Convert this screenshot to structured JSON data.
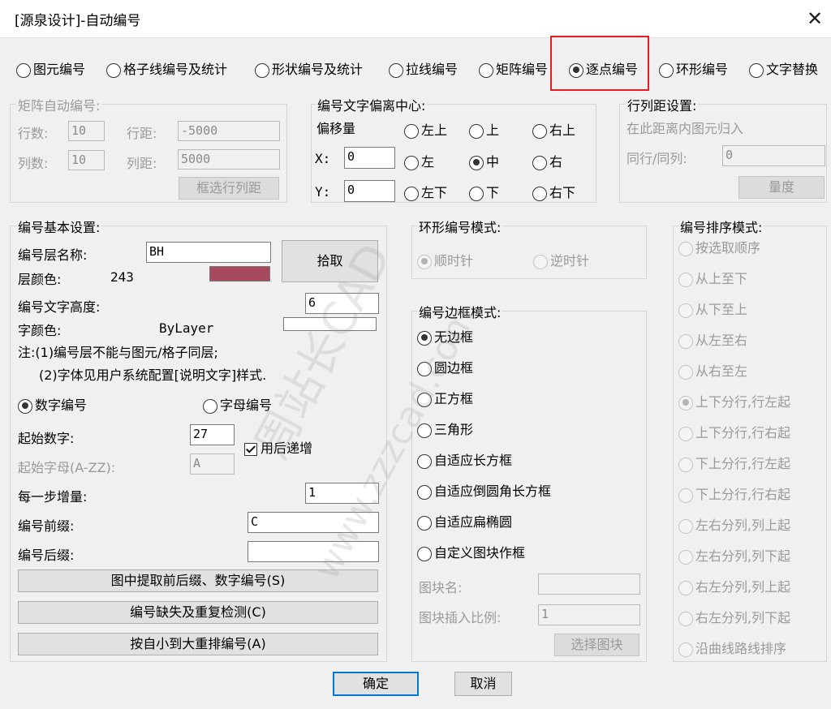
{
  "window": {
    "title": "[源泉设计]-自动编号",
    "close_glyph": "✕"
  },
  "mode_tabs": [
    {
      "label": "图元编号",
      "selected": false
    },
    {
      "label": "格子线编号及统计",
      "selected": false
    },
    {
      "label": "形状编号及统计",
      "selected": false
    },
    {
      "label": "拉线编号",
      "selected": false
    },
    {
      "label": "矩阵编号",
      "selected": false
    },
    {
      "label": "逐点编号",
      "selected": true
    },
    {
      "label": "环形编号",
      "selected": false
    },
    {
      "label": "文字替换",
      "selected": false
    }
  ],
  "matrix": {
    "title": "矩阵自动编号:",
    "rows_label": "行数:",
    "rows": "10",
    "row_dist_label": "行距:",
    "row_dist": "-5000",
    "cols_label": "列数:",
    "cols": "10",
    "col_dist_label": "列距:",
    "col_dist": "5000",
    "pick_btn": "框选行列距"
  },
  "offset": {
    "title": "编号文字偏离中心:",
    "amount_label": "偏移量",
    "x_label": "X:",
    "x": "0",
    "y_label": "Y:",
    "y": "0",
    "positions": [
      "左上",
      "上",
      "右上",
      "左",
      "中",
      "右",
      "左下",
      "下",
      "右下"
    ],
    "selected": "中"
  },
  "rowcol": {
    "title": "行列距设置:",
    "desc": "在此距离内图元归入",
    "same_label": "同行/同列:",
    "same_value": "0",
    "measure_btn": "量度"
  },
  "basic": {
    "title": "编号基本设置:",
    "layer_name_label": "编号层名称:",
    "layer_name": "BH",
    "pick_btn": "拾取",
    "layer_color_label": "层颜色:",
    "layer_color_value": "243",
    "layer_color_hex": "#a84a5f",
    "text_height_label": "编号文字高度:",
    "text_height": "6",
    "font_color_label": "字颜色:",
    "font_color_value": "ByLayer",
    "note1": "注:(1)编号层不能与图元/格子同层;",
    "note2": "(2)字体见用户系统配置[说明文字]样式.",
    "numeric_label": "数字编号",
    "alpha_label": "字母编号",
    "numeric_selected": true,
    "start_num_label": "起始数字:",
    "start_num": "27",
    "increment_after_label": "用后递增",
    "increment_after": true,
    "start_letter_label": "起始字母(A-ZZ):",
    "start_letter": "A",
    "step_label": "每一步增量:",
    "step": "1",
    "prefix_label": "编号前缀:",
    "prefix": "C",
    "suffix_label": "编号后缀:",
    "suffix": "",
    "extract_btn": "图中提取前后缀、数字编号(S)",
    "check_btn": "编号缺失及重复检测(C)",
    "renumber_btn": "按自小到大重排编号(A)"
  },
  "ring": {
    "title": "环形编号模式:",
    "clockwise": "顺时针",
    "counterclockwise": "逆时针"
  },
  "frame": {
    "title": "编号边框模式:",
    "options": [
      "无边框",
      "圆边框",
      "正方框",
      "三角形",
      "自适应长方框",
      "自适应倒圆角长方框",
      "自适应扁椭圆",
      "自定义图块作框"
    ],
    "selected": "无边框",
    "block_name_label": "图块名:",
    "block_name": "",
    "block_scale_label": "图块插入比例:",
    "block_scale": "1",
    "select_block_btn": "选择图块"
  },
  "sort": {
    "title": "编号排序模式:",
    "options": [
      "按选取顺序",
      "从上至下",
      "从下至上",
      "从左至右",
      "从右至左",
      "上下分行,行左起",
      "上下分行,行右起",
      "下上分行,行左起",
      "下上分行,行右起",
      "左右分列,列上起",
      "左右分列,列下起",
      "右左分列,列上起",
      "右左分列,列下起",
      "沿曲线路线排序"
    ],
    "selected": "上下分行,行左起"
  },
  "footer": {
    "ok": "确定",
    "cancel": "取消"
  },
  "watermark": {
    "text1": "周站长CAD",
    "text2": "www.zzzcad.com"
  },
  "colors": {
    "highlight": "#e02020",
    "accent": "#0078d7"
  }
}
